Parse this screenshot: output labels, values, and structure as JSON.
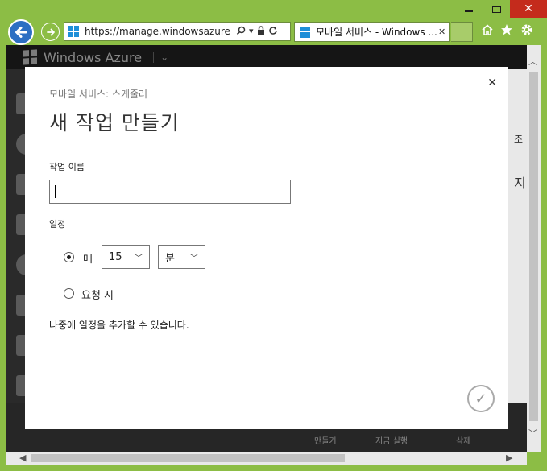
{
  "browser": {
    "address_url": "https://manage.windowsazure.c...",
    "tab_title": "모바일 서비스 - Windows ...",
    "tab_close": "✕",
    "window_min": "",
    "window_max": "",
    "window_close": "✕"
  },
  "azure": {
    "brand": "Windows Azure",
    "brand_chevron": "⌄",
    "bottom_labels": [
      "만들기",
      "지금 실행",
      "삭제"
    ],
    "bg_right_text": [
      "조",
      "지"
    ]
  },
  "dialog": {
    "breadcrumb": "모바일 서비스: 스케줄러",
    "title": "새 작업 만들기",
    "close": "✕",
    "job_name_label": "작업 이름",
    "job_name_value": "",
    "schedule_label": "일정",
    "option_every_label": "매",
    "interval_value": "15",
    "unit_value": "분",
    "option_on_demand_label": "요청 시",
    "note": "나중에 일정을 추가할 수 있습니다.",
    "confirm_icon": "✓",
    "selected_option": "every"
  },
  "colors": {
    "window_frame": "#8cbd45",
    "close_red": "#c42b1c",
    "back_button_blue": "#2c6fc3",
    "azure_dark": "#1d1d1d"
  }
}
